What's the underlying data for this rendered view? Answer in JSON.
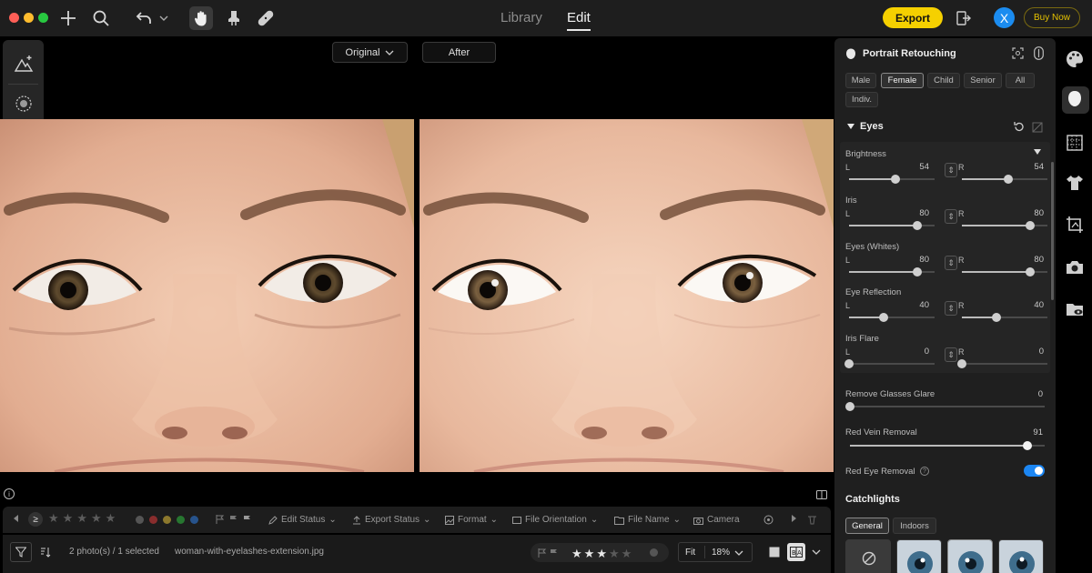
{
  "colors": {
    "close": "#fe5f57",
    "minimize": "#febc2e",
    "zoom": "#28c840",
    "accent": "#f5d000",
    "toggle_on": "#1c86f2"
  },
  "topbar": {
    "icons": [
      "plus-icon",
      "search-icon",
      "undo-icon",
      "chevron-down-icon",
      "hand-icon",
      "stamp-icon",
      "bandage-icon"
    ],
    "tabs": [
      {
        "label": "Library"
      },
      {
        "label": "Edit"
      }
    ],
    "export_label": "Export",
    "avatar_letter": "X",
    "buy_label": "Buy Now"
  },
  "left_tools": {
    "icons": [
      "mountain-sparkle-icon",
      "radial-mask-icon",
      "history-icon"
    ]
  },
  "compare": {
    "original_label": "Original",
    "after_label": "After"
  },
  "filter_bar": {
    "edit_status": "Edit Status",
    "export_status": "Export Status",
    "format": "Format",
    "file_orientation": "File Orientation",
    "file_name": "File Name",
    "camera": "Camera",
    "dot_colors": [
      "#e23b3b",
      "#e8c33a",
      "#2fbf3f",
      "#2f7fe8"
    ]
  },
  "status_bar": {
    "selection": "2 photo(s) / 1 selected",
    "filename": "woman-with-eyelashes-extension.jpg",
    "rating": 3,
    "rating_max": 5,
    "fit_label": "Fit",
    "zoom_label": "18%"
  },
  "panel": {
    "title": "Portrait Retouching",
    "chips": [
      "Male",
      "Female",
      "Child",
      "Senior",
      "All",
      "Indiv."
    ],
    "selected_chip": "Female",
    "eyes_title": "Eyes",
    "sliders": [
      {
        "label": "Brightness",
        "left_label": "L",
        "right_label": "R",
        "left": "54",
        "right": "54"
      },
      {
        "label": "Iris",
        "left_label": "L",
        "right_label": "R",
        "left": "80",
        "right": "80"
      },
      {
        "label": "Eyes (Whites)",
        "left_label": "L",
        "right_label": "R",
        "left": "80",
        "right": "80"
      },
      {
        "label": "Eye Reflection",
        "left_label": "L",
        "right_label": "R",
        "left": "40",
        "right": "40"
      },
      {
        "label": "Iris Flare",
        "left_label": "L",
        "right_label": "R",
        "left": "0",
        "right": "0"
      }
    ],
    "glasses_glare": {
      "label": "Remove Glasses Glare",
      "value": "0"
    },
    "red_vein": {
      "label": "Red Vein Removal",
      "value": "91"
    },
    "red_eye": {
      "label": "Red Eye Removal",
      "enabled": true
    },
    "catchlights_title": "Catchlights",
    "catchlight_tabs": [
      "General",
      "Indoors"
    ]
  },
  "rail": {
    "icons": [
      "palette-icon",
      "face-icon",
      "texture-icon",
      "shirt-icon",
      "crop-icon",
      "camera-icon",
      "folder-eye-icon"
    ]
  }
}
